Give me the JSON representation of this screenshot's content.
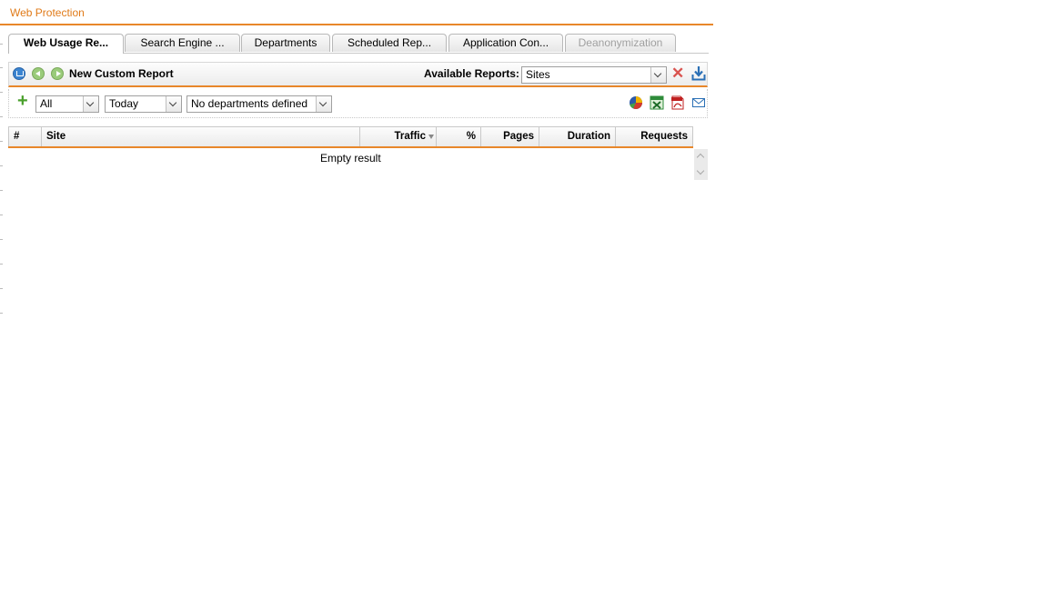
{
  "app": {
    "title": "Web Protection"
  },
  "tabs": [
    {
      "label": "Web Usage Re...",
      "state": "active"
    },
    {
      "label": "Search Engine ...",
      "state": "normal"
    },
    {
      "label": "Departments",
      "state": "normal"
    },
    {
      "label": "Scheduled Rep...",
      "state": "normal"
    },
    {
      "label": "Application Con...",
      "state": "normal"
    },
    {
      "label": "Deanonymization",
      "state": "disabled"
    }
  ],
  "toolbar": {
    "report_title": "New Custom Report",
    "available_label": "Available Reports:",
    "available_value": "Sites"
  },
  "filters": {
    "scope": "All",
    "period": "Today",
    "departments": "No departments defined"
  },
  "icons": {
    "home": "home-icon",
    "back": "back-arrow-icon",
    "forward": "forward-arrow-icon",
    "delete": "close-icon",
    "save": "download-icon",
    "add": "plus-icon",
    "chart": "pie-chart-icon",
    "excel": "xls-icon",
    "pdf": "pdf-icon",
    "mail": "mail-icon"
  },
  "colors": {
    "accent": "#e8872a",
    "title": "#e07a18",
    "delete": "#d9534f",
    "add": "#4aa02c"
  },
  "table": {
    "columns": [
      "#",
      "Site",
      "Traffic",
      "%",
      "Pages",
      "Duration",
      "Requests"
    ],
    "sorted_by": "Traffic",
    "empty_text": "Empty result"
  }
}
